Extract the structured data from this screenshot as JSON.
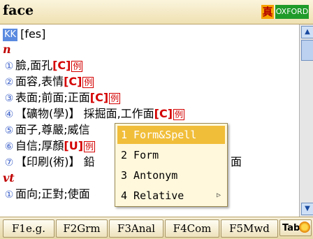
{
  "header": {
    "title": "face",
    "dict_badge": "真",
    "dict_name": "OXFORD"
  },
  "entry": {
    "kk_label": "KK",
    "phonetic": "[fes]",
    "pos_n": "n",
    "pos_vt": "vt",
    "senses": [
      {
        "num": "①",
        "text": "臉,面孔",
        "tag": "[C]",
        "ex": "例"
      },
      {
        "num": "②",
        "text": "面容,表情",
        "tag": "[C]",
        "ex": "例"
      },
      {
        "num": "③",
        "text": "表面;前面;正面",
        "tag": "[C]",
        "ex": "例"
      },
      {
        "num": "④",
        "text": "【礦物(學)】 採掘面,工作面",
        "tag": "[C]",
        "ex": "例"
      },
      {
        "num": "⑤",
        "text": "面子,尊嚴;威信",
        "tag": "",
        "ex": ""
      },
      {
        "num": "⑥",
        "text": "自信;厚顏",
        "tag": "[U]",
        "ex": "例"
      },
      {
        "num": "⑦",
        "text": "【印刷(術)】 鉛",
        "tag": "",
        "ex": "",
        "tail": "面"
      }
    ],
    "vt_senses": [
      {
        "num": "①",
        "text": "面向;正對;使面"
      }
    ]
  },
  "popup_menu": {
    "items": [
      {
        "label": "1 Form&Spell",
        "selected": true
      },
      {
        "label": "2 Form",
        "selected": false
      },
      {
        "label": "3 Antonym",
        "selected": false
      },
      {
        "label": "4 Relative",
        "selected": false,
        "submenu_arrow": "▷"
      }
    ]
  },
  "toolbar": {
    "buttons": [
      "F1e.g.",
      "F2Grm",
      "F3Anal",
      "F4Com",
      "F5Mwd",
      "Tab"
    ]
  },
  "scrollbar": {
    "up_arrow": "▲",
    "down_arrow": "▼"
  }
}
